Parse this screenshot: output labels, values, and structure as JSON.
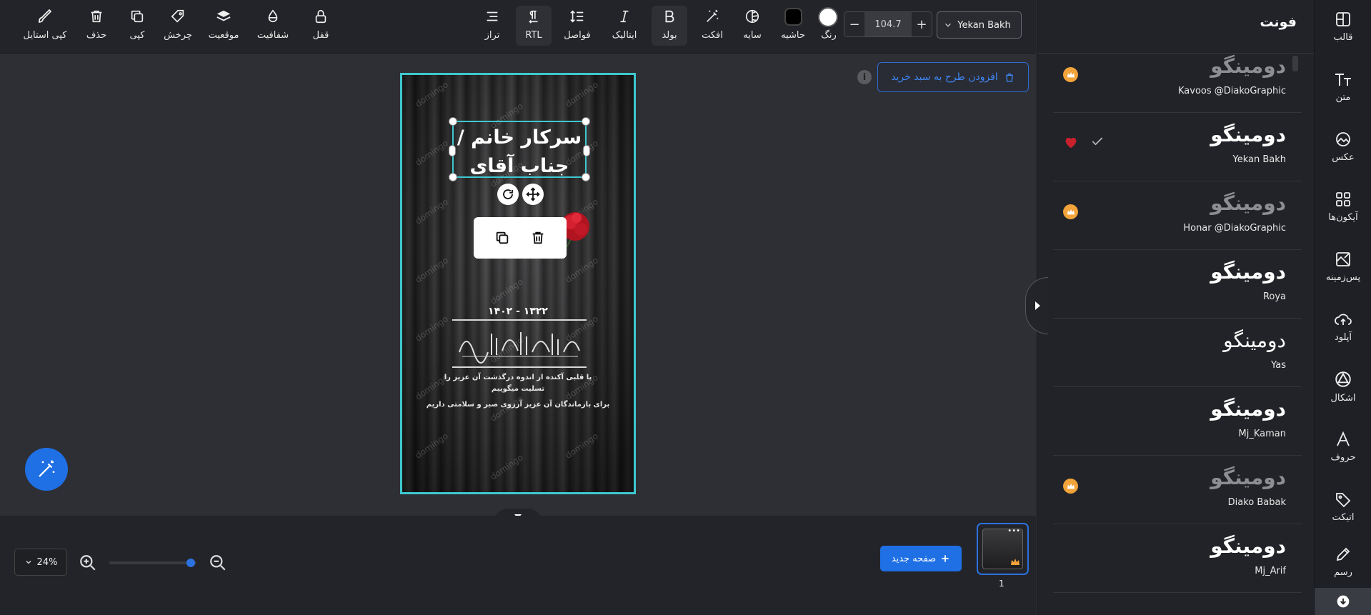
{
  "toolbar": {
    "copy_style": "کپی استایل",
    "delete": "حذف",
    "copy": "کپی",
    "rotate": "چرخش",
    "position": "موقعیت",
    "opacity": "شفافیت",
    "lock": "قفل",
    "align": "تراز",
    "rtl": "RTL",
    "spacing": "فواصل",
    "italic": "ایتالیک",
    "bold": "بولد",
    "effect": "افکت",
    "shadow": "سایه",
    "border": "حاشیه",
    "color": "رنگ",
    "font_size": "104.7",
    "font_family": "Yekan Bakh"
  },
  "panel": {
    "title": "فونت",
    "fonts": [
      {
        "sample": "دومینگو",
        "name": "Kavoos @DiakoGraphic",
        "premium": true,
        "selected": false
      },
      {
        "sample": "دومینگو",
        "name": "Yekan Bakh",
        "premium": false,
        "selected": true
      },
      {
        "sample": "دومینگو",
        "name": "Honar @DiakoGraphic",
        "premium": true,
        "selected": false
      },
      {
        "sample": "دومینگو",
        "name": "Roya",
        "premium": false,
        "selected": false
      },
      {
        "sample": "دومینگو",
        "name": "Yas",
        "premium": false,
        "selected": false
      },
      {
        "sample": "دومینگو",
        "name": "Mj_Kaman",
        "premium": false,
        "selected": false
      },
      {
        "sample": "دومینگو",
        "name": "Diako Babak",
        "premium": true,
        "selected": false
      },
      {
        "sample": "دومینگو",
        "name": "Mj_Arif",
        "premium": false,
        "selected": false
      }
    ]
  },
  "rail": {
    "template": "قالب",
    "text": "متن",
    "photo": "عکس",
    "icons": "آیکون‌ها",
    "background": "پس‌زمینه",
    "upload": "آپلود",
    "shapes": "اشکال",
    "letters": "حروف",
    "sticker": "اتیکت",
    "draw": "رسم"
  },
  "canvas": {
    "add_to_cart": "افزودن طرح به سبد خرید",
    "poster_title_line1": "سرکار خانم /",
    "poster_title_line2": "جناب آقای",
    "years": "۱۳۲۲ - ۱۴۰۲",
    "condolence_line1": "با قلبی آکنده از اندوه درگذشت آن عزیز را",
    "condolence_line2": "تسلیت میگوییم",
    "condolence_line3": "برای بازماندگان آن عزیز آرزوی صبر و سلامتی داریم",
    "watermark": "domingo"
  },
  "bottom": {
    "zoom": "24%",
    "new_page": "صفحه جدید",
    "page_number": "1"
  },
  "colors": {
    "accent": "#1f6fe5",
    "selection": "#3ec8cf",
    "premium": "#f2a33a",
    "favorite": "#c8202d"
  }
}
